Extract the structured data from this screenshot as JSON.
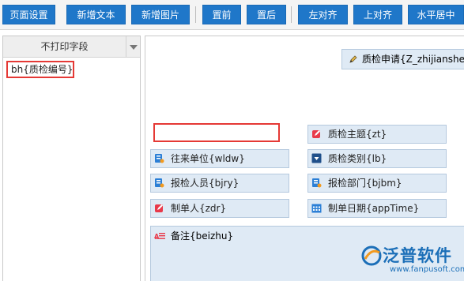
{
  "toolbar": {
    "buttons": [
      "页面设置",
      "新增文本",
      "新增图片",
      "置前",
      "置后",
      "左对齐",
      "上对齐",
      "水平居中"
    ]
  },
  "left_panel": {
    "header": "不打印字段",
    "items": [
      "bh{质检编号}"
    ]
  },
  "canvas": {
    "title_field": "质检申请{Z_zhijianshe",
    "fields": {
      "subject": "质检主题{zt}",
      "partner": "往来单位{wldw}",
      "category": "质检类别{lb}",
      "inspector": "报检人员{bjry}",
      "department": "报检部门{bjbm}",
      "creator": "制单人{zdr}",
      "date": "制单日期{appTime}",
      "remark": "备注{beizhu}"
    }
  },
  "logo": {
    "name": "泛普软件",
    "url": "www.fanpusoft.com"
  },
  "colors": {
    "toolbar_button": "#1f77c9",
    "cell_background": "#dfeaf5",
    "highlight_border": "#e53935"
  }
}
